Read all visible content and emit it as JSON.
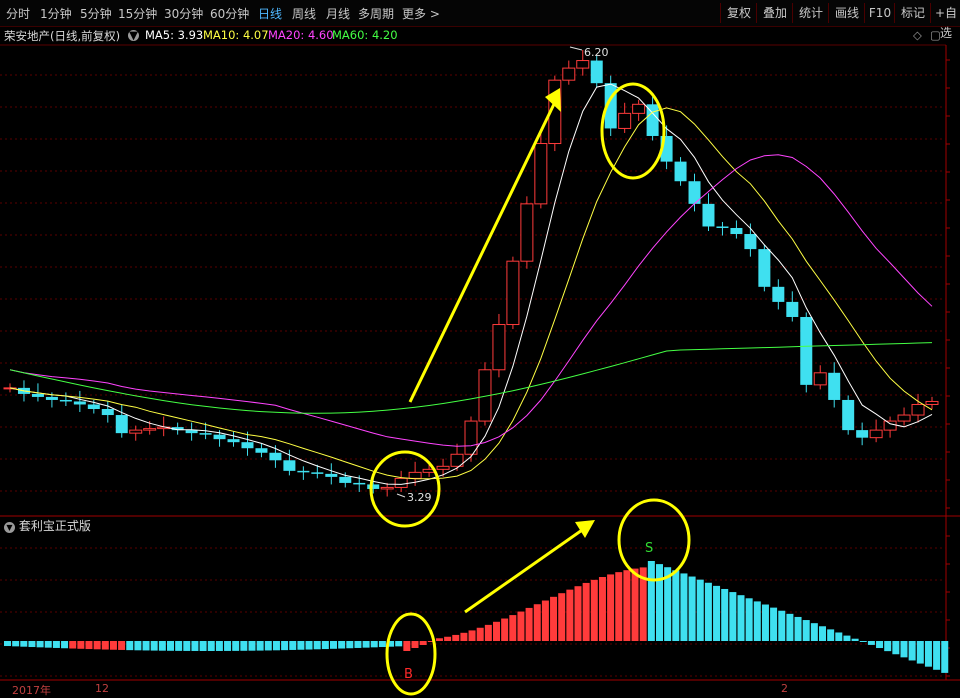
{
  "toolbar": {
    "periods": [
      "分时",
      "1分钟",
      "5分钟",
      "15分钟",
      "30分钟",
      "60分钟",
      "日线",
      "周线",
      "月线",
      "多周期",
      "更多 >"
    ],
    "active_period": "日线",
    "right_buttons": [
      "复权",
      "叠加",
      "统计",
      "画线",
      "F10",
      "标记",
      "+自选"
    ]
  },
  "stock": {
    "title": "荣安地产(日线,前复权)",
    "ma": [
      {
        "label": "MA5: 3.93",
        "color": "#ffffff"
      },
      {
        "label": "MA10: 4.07",
        "color": "#ffff44"
      },
      {
        "label": "MA20: 4.60",
        "color": "#ff44ff"
      },
      {
        "label": "MA60: 4.20",
        "color": "#44ff44"
      }
    ]
  },
  "chart": {
    "high_label": "6.20",
    "low_label": "3.29"
  },
  "indicator": {
    "name": "套利宝正式版",
    "buy_mark": "B",
    "sell_mark": "S"
  },
  "x_axis": {
    "labels": [
      "2017年",
      "12",
      "2"
    ]
  },
  "colors": {
    "up": "#ff3b3b",
    "down": "#3fe0f0",
    "ma5": "#ffffff",
    "ma10": "#ffff44",
    "ma20": "#ff44ff",
    "ma60": "#44ff44",
    "annotation": "#ffff00",
    "grid": "#5a0000"
  }
}
